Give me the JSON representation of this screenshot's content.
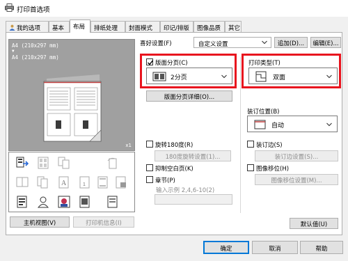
{
  "window": {
    "title": "打印首选项"
  },
  "tabs": [
    {
      "label": "我的选项",
      "active": false
    },
    {
      "label": "基本",
      "active": false
    },
    {
      "label": "布局",
      "active": true
    },
    {
      "label": "排纸处理",
      "active": false
    },
    {
      "label": "封面模式",
      "active": false
    },
    {
      "label": "印记/排版",
      "active": false
    },
    {
      "label": "图像品质",
      "active": false
    },
    {
      "label": "其它",
      "active": false
    }
  ],
  "preview": {
    "line1": "A4 (210x297 mm)",
    "arrow": "▼",
    "line2": "A4 (210x297 mm)",
    "scale": "x1"
  },
  "left_buttons": {
    "host_view": "主机视图(V)",
    "printer_info": "打印机信息(I)"
  },
  "favorites": {
    "label": "喜好设置(F)",
    "value": "自定义设置",
    "add_button": "追加(D)...",
    "edit_button": "编辑(E)..."
  },
  "combination": {
    "checkbox_label": "版面分页(C)",
    "checked": true,
    "value": "2分页",
    "detail_button": "版面分页详细(O)..."
  },
  "print_type": {
    "label": "打印类型(T)",
    "value": "双面"
  },
  "binding_position": {
    "label": "装订位置(B)",
    "value": "自动"
  },
  "rotate180": {
    "label": "旋转180度(R)",
    "button": "180度旋转设置(1)..."
  },
  "suppress_blank": {
    "label": "抑制空白页(K)"
  },
  "chapter": {
    "label": "章节(P)",
    "hint": "输入示例 2,4,6-10(2)"
  },
  "binding_margin": {
    "label": "装订边(S)",
    "button": "装订边设置(S)..."
  },
  "image_shift": {
    "label": "图像移位(H)",
    "button": "图像移位设置(M)..."
  },
  "defaults_button": "默认值(U)",
  "footer": {
    "ok": "确定",
    "cancel": "取消",
    "help": "帮助"
  },
  "colors": {
    "highlight": "#e8141e",
    "selected_border": "#0078d7"
  }
}
